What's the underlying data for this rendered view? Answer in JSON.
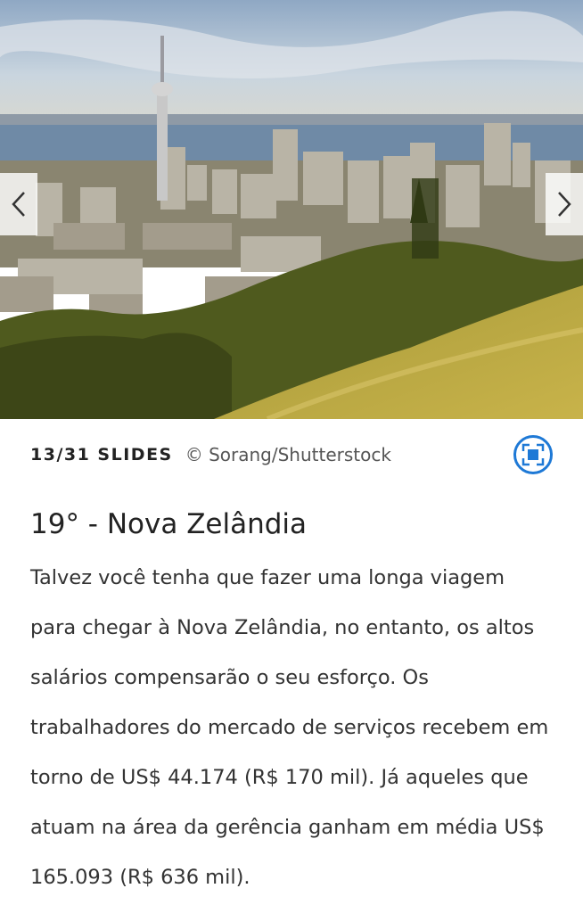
{
  "slideshow": {
    "image_alt": "Auckland skyline with Sky Tower",
    "nav": {
      "prev_icon": "chevron-left-icon",
      "next_icon": "chevron-right-icon"
    },
    "counter": "13/31 SLIDES",
    "credit": "© Sorang/Shutterstock",
    "expand_icon": "fullscreen-icon",
    "accent_color": "#1e79d6"
  },
  "article": {
    "title": "19° - Nova Zelândia",
    "body": "Talvez você tenha que fazer uma longa viagem para chegar à Nova Zelândia, no entanto, os altos salários compensarão o seu esforço. Os trabalhadores do mercado de serviços recebem em torno de US$ 44.174 (R$ 170 mil). Já aqueles que atuam na área da gerência ganham em média US$ 165.093 (R$ 636 mil)."
  }
}
